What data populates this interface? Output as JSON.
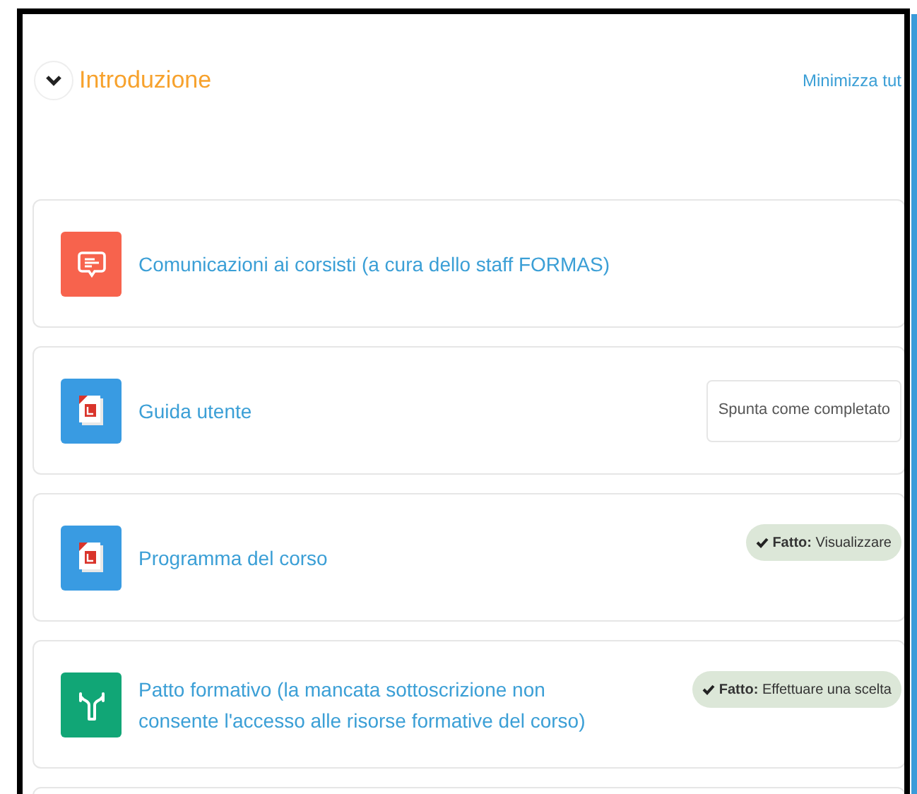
{
  "section": {
    "title": "Introduzione",
    "expanded": true,
    "collapse_all": "Minimizza tut"
  },
  "activities": [
    {
      "kind": "forum",
      "name": "Comunicazioni ai corsisti (a cura dello staff FORMAS)"
    },
    {
      "kind": "pdf",
      "name": "Guida utente",
      "completion": {
        "kind": "manual",
        "label": "Spunta come completato"
      }
    },
    {
      "kind": "pdf",
      "name": "Programma del corso",
      "completion": {
        "kind": "done",
        "label": "**Fatto:** Visualizzare"
      }
    },
    {
      "kind": "choice",
      "name": "Patto formativo (la mancata sottoscrizione non consente l'accesso alle risorse formative del corso)",
      "completion": {
        "kind": "done",
        "label": "**Fatto:** Effettuare una scelta"
      }
    }
  ]
}
